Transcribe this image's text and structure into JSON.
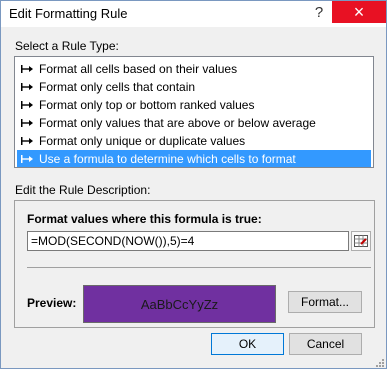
{
  "window": {
    "title": "Edit Formatting Rule",
    "help_label": "?",
    "close_label": "×"
  },
  "rule_type": {
    "label": "Select a Rule Type:",
    "items": [
      "Format all cells based on their values",
      "Format only cells that contain",
      "Format only top or bottom ranked values",
      "Format only values that are above or below average",
      "Format only unique or duplicate values",
      "Use a formula to determine which cells to format"
    ],
    "selected_index": 5
  },
  "description": {
    "label": "Edit the Rule Description:",
    "heading": "Format values where this formula is true:",
    "formula_value": "=MOD(SECOND(NOW()),5)=4",
    "preview_label": "Preview:",
    "preview_sample": "AaBbCcYyZz",
    "preview_fill_color": "#7030a0",
    "format_button_label": "Format..."
  },
  "buttons": {
    "ok_label": "OK",
    "cancel_label": "Cancel"
  },
  "icons": {
    "rule_bullet": "arrow-bullet-icon",
    "range_picker": "range-select-icon",
    "help": "help-icon",
    "close": "close-icon"
  }
}
